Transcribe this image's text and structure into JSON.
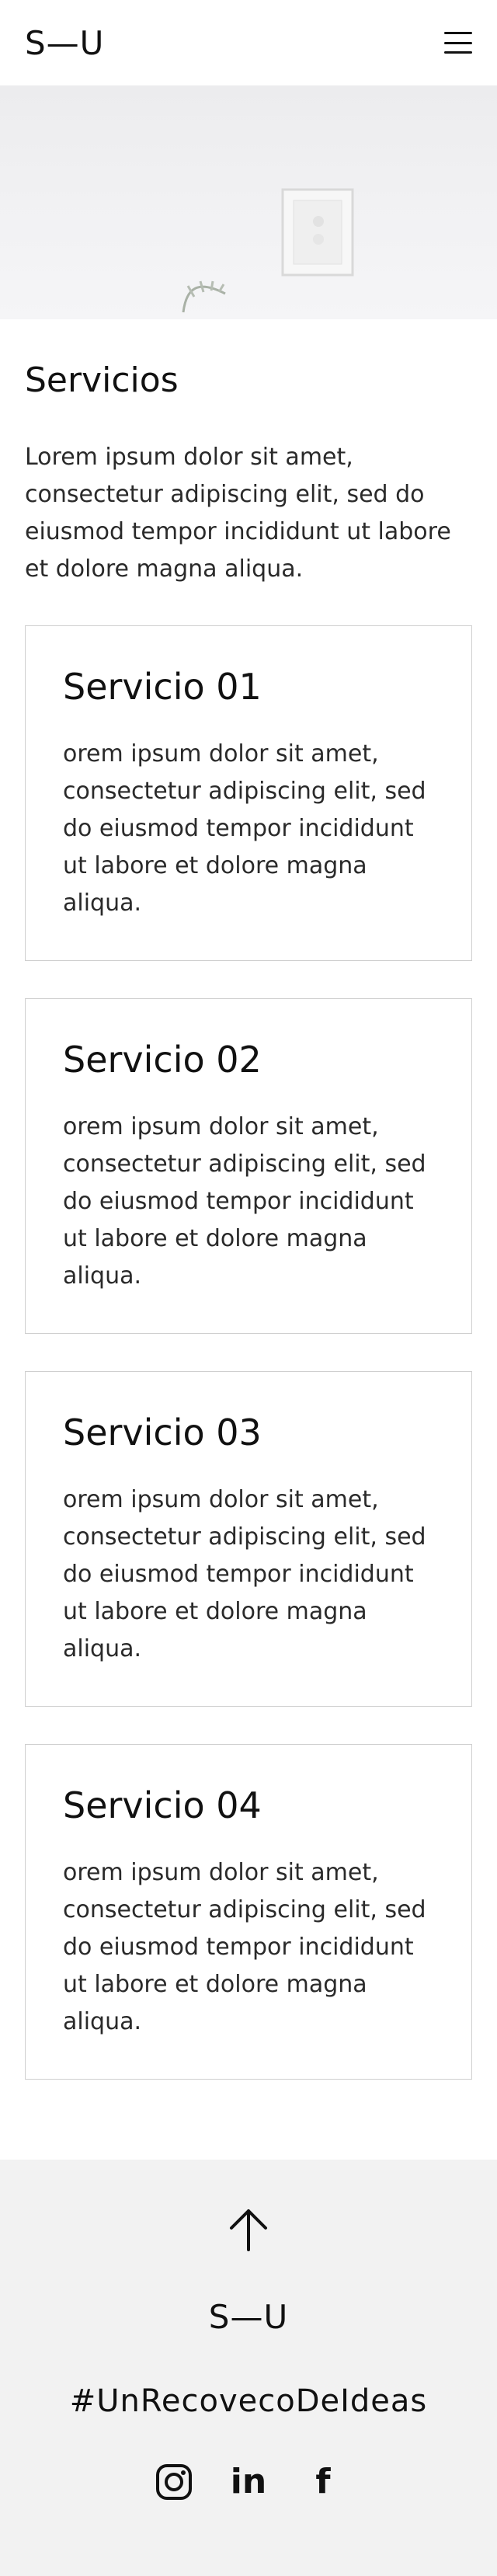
{
  "header": {
    "logo": "S—U",
    "menu_icon": "hamburger-menu-icon"
  },
  "hero": {
    "image": "desk-chair-workspace-photo"
  },
  "services": {
    "title": "Servicios",
    "intro": "Lorem ipsum dolor sit amet, consectetur adipiscing elit, sed do eiusmod tempor incididunt ut labore et dolore magna aliqua.",
    "items": [
      {
        "title": "Servicio 01",
        "text": "orem ipsum dolor sit amet, consectetur adipiscing elit, sed do eiusmod tempor incididunt ut labore et dolore magna aliqua."
      },
      {
        "title": "Servicio 02",
        "text": "orem ipsum dolor sit amet, consectetur adipiscing elit, sed do eiusmod tempor incididunt ut labore et dolore magna aliqua."
      },
      {
        "title": "Servicio 03",
        "text": "orem ipsum dolor sit amet, consectetur adipiscing elit, sed do eiusmod tempor incididunt ut labore et dolore magna aliqua."
      },
      {
        "title": "Servicio 04",
        "text": "orem ipsum dolor sit amet, consectetur adipiscing elit, sed do eiusmod tempor incididunt ut labore et dolore magna aliqua."
      }
    ]
  },
  "footer": {
    "up_icon": "arrow-up-icon",
    "logo": "S—U",
    "hashtag": "#UnRecovecoDeIdeas",
    "social": [
      {
        "name": "instagram-icon"
      },
      {
        "name": "linkedin-icon",
        "glyph": "in"
      },
      {
        "name": "facebook-icon",
        "glyph": "f"
      }
    ]
  },
  "colors": {
    "text": "#111111",
    "footer_bg": "#f2f2f2",
    "card_border": "#cfcfcf"
  }
}
